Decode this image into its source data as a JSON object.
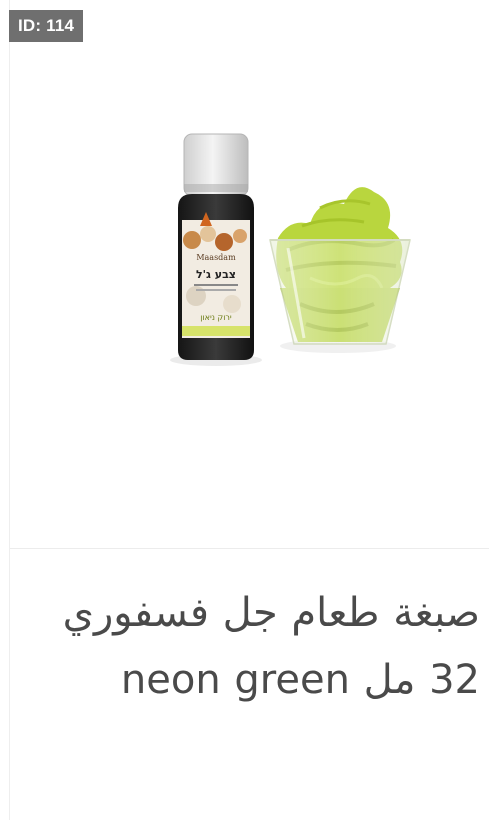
{
  "badge": {
    "id_label": "ID: 114"
  },
  "product": {
    "title": "صبغة طعام جل فسفوري 32 مل neon green",
    "image_icon": "product-photo-gel-color-bottle-and-cream-cup",
    "bottle_brand_text": "Maasdam",
    "bottle_label_text": "צבע ג'ל",
    "bottle_sub_text": "ירוק ניאון"
  },
  "colors": {
    "badge_bg": "#6f6f6f",
    "title_text": "#4a4a4a",
    "cream_green": "#b7d33a"
  }
}
